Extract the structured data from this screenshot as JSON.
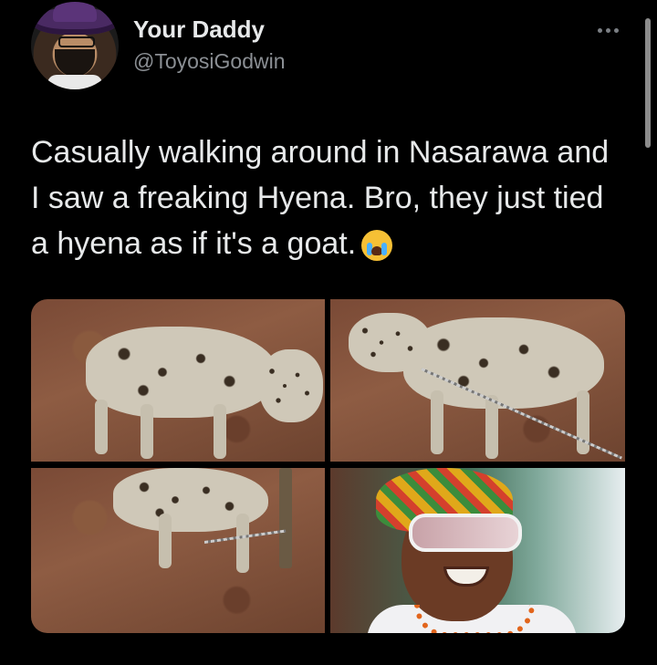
{
  "tweet": {
    "author_name": "Your Daddy",
    "author_handle": "@ToyosiGodwin",
    "text": "Casually walking around in Nasarawa and I saw a freaking Hyena. Bro, they just tied a hyena as if it's a goat.",
    "emoji": "loudly-crying-face-emoji"
  },
  "media": [
    {
      "subject": "hyena-standing-muzzled"
    },
    {
      "subject": "hyena-chained-walking"
    },
    {
      "subject": "hyena-tied-to-stake"
    },
    {
      "subject": "woman-with-sunglasses-smiling"
    }
  ],
  "icons": {
    "more": "more-options-icon"
  },
  "colors": {
    "background": "#000000",
    "text": "#e7e9ea",
    "secondary": "#8b8f94"
  }
}
